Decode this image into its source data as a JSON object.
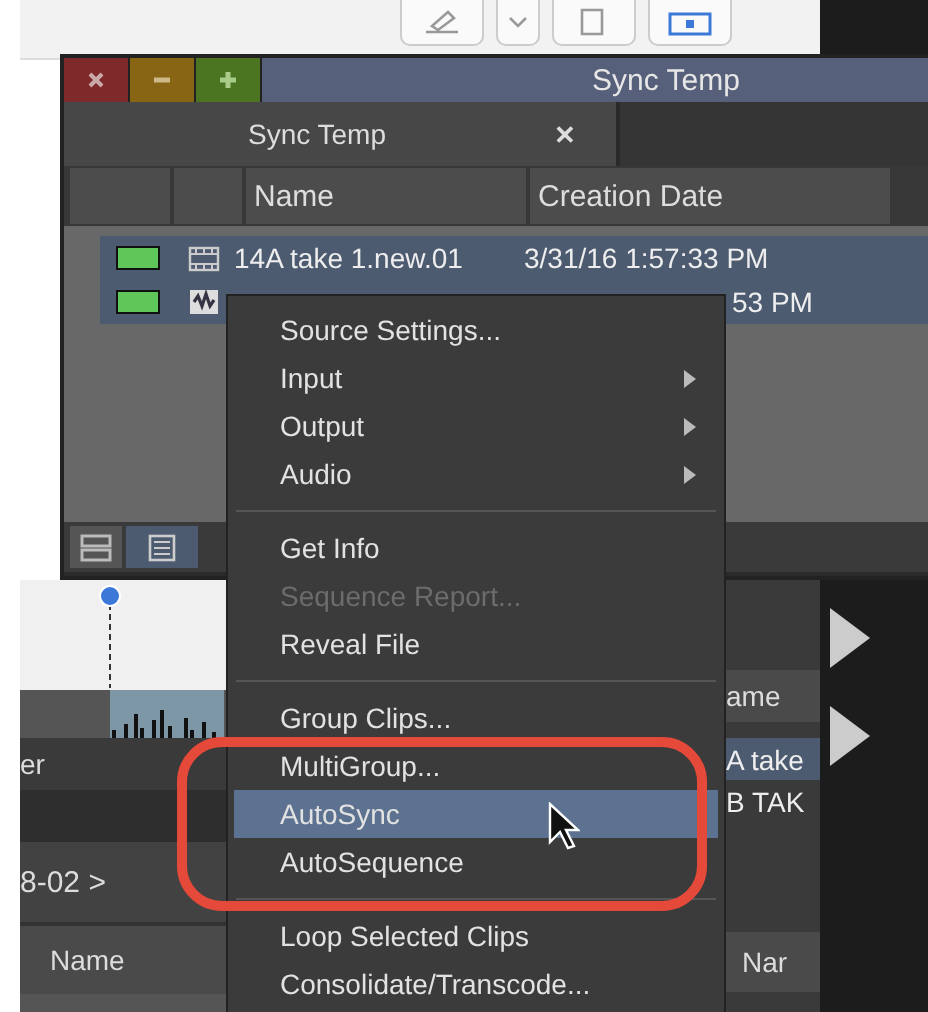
{
  "bin_window": {
    "title": "Sync Temp",
    "tab": {
      "label": "Sync Temp",
      "close": "✕"
    },
    "columns": [
      "Name",
      "Creation Date"
    ],
    "rows": [
      {
        "kind": "sequence",
        "name": "14A take 1.new.01",
        "date": "3/31/16 1:57:33 PM",
        "selected": true
      },
      {
        "kind": "clip",
        "date": "53 PM",
        "selected": true
      }
    ],
    "views": [
      {
        "kind": "frame",
        "selected": false
      },
      {
        "kind": "list",
        "selected": true
      }
    ]
  },
  "left_panel": {
    "label": "er",
    "breadcrumb": "8-02 >",
    "column": "Name"
  },
  "right_panel": {
    "column": "ame",
    "rows": [
      {
        "name": "A take",
        "selected": true
      },
      {
        "name": "B TAK",
        "selected": false
      }
    ],
    "column_2": "Nar"
  },
  "context_menu": [
    {
      "label": "Source Settings...",
      "submenu": false,
      "disabled": false,
      "selected": false
    },
    {
      "label": "Input",
      "submenu": true,
      "disabled": false,
      "selected": false
    },
    {
      "label": "Output",
      "submenu": true,
      "disabled": false,
      "selected": false
    },
    {
      "label": "Audio",
      "submenu": true,
      "disabled": false,
      "selected": false
    },
    {
      "kind": "separator"
    },
    {
      "label": "Get Info",
      "submenu": false,
      "disabled": false,
      "selected": false
    },
    {
      "label": "Sequence Report...",
      "submenu": false,
      "disabled": true,
      "selected": false
    },
    {
      "label": "Reveal File",
      "submenu": false,
      "disabled": false,
      "selected": false
    },
    {
      "kind": "separator"
    },
    {
      "label": "Group Clips...",
      "submenu": false,
      "disabled": false,
      "selected": false
    },
    {
      "label": "MultiGroup...",
      "submenu": false,
      "disabled": false,
      "selected": false
    },
    {
      "label": "AutoSync",
      "submenu": false,
      "disabled": false,
      "selected": true
    },
    {
      "label": "AutoSequence",
      "submenu": false,
      "disabled": false,
      "selected": false
    },
    {
      "kind": "separator"
    },
    {
      "label": "Loop Selected Clips",
      "submenu": false,
      "disabled": false,
      "selected": false
    },
    {
      "label": "Consolidate/Transcode...",
      "submenu": false,
      "disabled": false,
      "selected": false
    }
  ]
}
